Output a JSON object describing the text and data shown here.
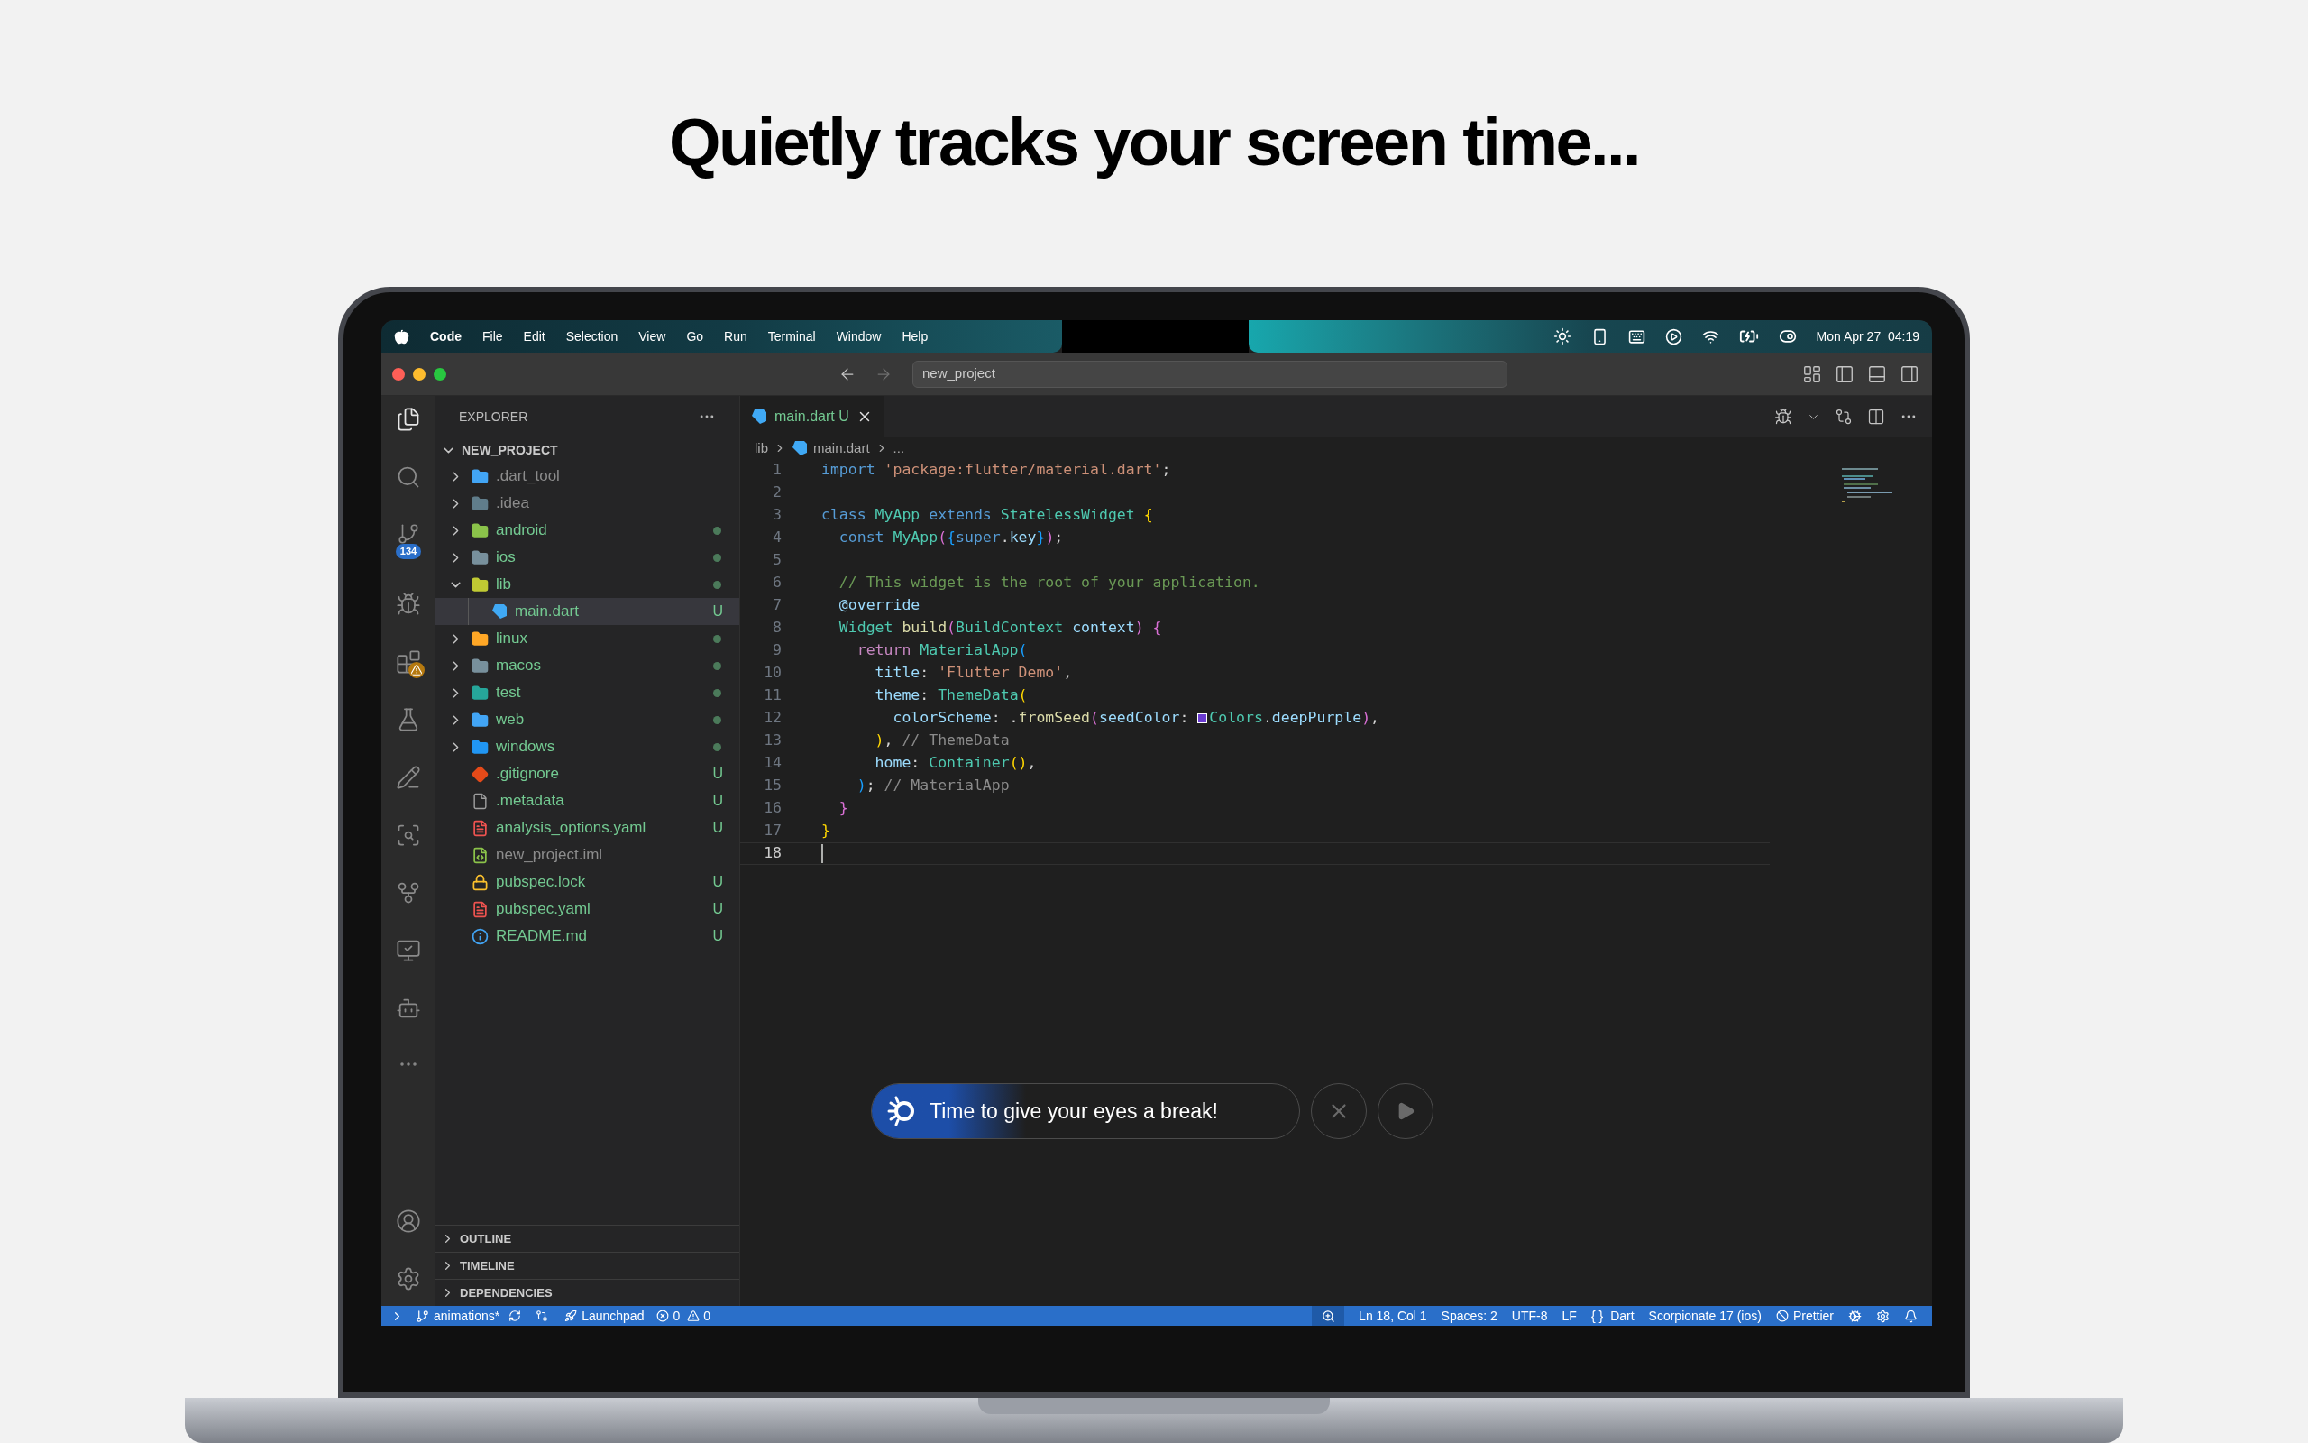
{
  "headline": "Quietly tracks your screen time...",
  "menu_bar": {
    "items": [
      {
        "label": "Code",
        "bold": true
      },
      {
        "label": "File",
        "bold": false
      },
      {
        "label": "Edit",
        "bold": false
      },
      {
        "label": "Selection",
        "bold": false
      },
      {
        "label": "View",
        "bold": false
      },
      {
        "label": "Go",
        "bold": false
      },
      {
        "label": "Run",
        "bold": false
      },
      {
        "label": "Terminal",
        "bold": false
      },
      {
        "label": "Window",
        "bold": false
      },
      {
        "label": "Help",
        "bold": false
      }
    ],
    "clock": "Mon Apr 27  04:19"
  },
  "title_bar": {
    "search": "new_project"
  },
  "activity_bar": {
    "source_control_badge": "134"
  },
  "explorer": {
    "title": "EXPLORER",
    "root": "NEW_PROJECT",
    "items": [
      {
        "name": ".dart_tool",
        "kind": "folder",
        "color": "#42a5f5",
        "expanded": false,
        "ignored": true,
        "dot": false,
        "selected": false
      },
      {
        "name": ".idea",
        "kind": "folder",
        "color": "#607d8b",
        "expanded": false,
        "ignored": true,
        "dot": false,
        "selected": false
      },
      {
        "name": "android",
        "kind": "folder",
        "color": "#8bc34a",
        "expanded": false,
        "ignored": false,
        "dot": true,
        "selected": false
      },
      {
        "name": "ios",
        "kind": "folder",
        "color": "#78909c",
        "expanded": false,
        "ignored": false,
        "dot": true,
        "selected": false
      },
      {
        "name": "lib",
        "kind": "folder",
        "color": "#c0ca33",
        "expanded": true,
        "ignored": false,
        "dot": true,
        "selected": false,
        "children": [
          {
            "name": "main.dart",
            "kind": "dart",
            "color": "#40a9f5",
            "ignored": false,
            "dot": false,
            "git": "U",
            "selected": true
          }
        ]
      },
      {
        "name": "linux",
        "kind": "folder",
        "color": "#ffa726",
        "expanded": false,
        "ignored": false,
        "dot": true,
        "selected": false
      },
      {
        "name": "macos",
        "kind": "folder",
        "color": "#78909c",
        "expanded": false,
        "ignored": false,
        "dot": true,
        "selected": false
      },
      {
        "name": "test",
        "kind": "folder",
        "color": "#26a69a",
        "expanded": false,
        "ignored": false,
        "dot": true,
        "selected": false
      },
      {
        "name": "web",
        "kind": "folder",
        "color": "#42a5f5",
        "expanded": false,
        "ignored": false,
        "dot": true,
        "selected": false
      },
      {
        "name": "windows",
        "kind": "folder",
        "color": "#2196f3",
        "expanded": false,
        "ignored": false,
        "dot": true,
        "selected": false
      },
      {
        "name": ".gitignore",
        "kind": "git",
        "color": "#e64a19",
        "ignored": false,
        "dot": false,
        "git": "U",
        "selected": false
      },
      {
        "name": ".metadata",
        "kind": "file",
        "color": "#9e9e9e",
        "ignored": false,
        "dot": false,
        "git": "U",
        "selected": false
      },
      {
        "name": "analysis_options.yaml",
        "kind": "doc",
        "color": "#ef5350",
        "ignored": false,
        "dot": false,
        "git": "U",
        "selected": false
      },
      {
        "name": "new_project.iml",
        "kind": "code",
        "color": "#8bc34a",
        "ignored": true,
        "dot": false,
        "selected": false
      },
      {
        "name": "pubspec.lock",
        "kind": "lock",
        "color": "#fbc02d",
        "ignored": false,
        "dot": false,
        "git": "U",
        "selected": false
      },
      {
        "name": "pubspec.yaml",
        "kind": "doc",
        "color": "#ef5350",
        "ignored": false,
        "dot": false,
        "git": "U",
        "selected": false
      },
      {
        "name": "README.md",
        "kind": "info",
        "color": "#42a5f5",
        "ignored": false,
        "dot": false,
        "git": "U",
        "selected": false
      }
    ],
    "sections": [
      {
        "label": "OUTLINE",
        "expanded": false
      },
      {
        "label": "TIMELINE",
        "expanded": false
      },
      {
        "label": "DEPENDENCIES",
        "expanded": false
      }
    ]
  },
  "editor": {
    "tab": {
      "label": "main.dart",
      "git": "U",
      "selected": true
    },
    "breadcrumb": [
      "lib",
      "main.dart",
      "..."
    ],
    "lines": [
      {
        "n": "1",
        "current": false,
        "tokens": [
          {
            "text": "import",
            "kind": "kw"
          },
          {
            "text": " 'package:flutter/material.dart'",
            "kind": "str"
          },
          {
            "text": ";",
            "kind": "p"
          }
        ]
      },
      {
        "n": "2",
        "current": false
      },
      {
        "n": "3",
        "current": false,
        "tokens": [
          {
            "text": "class",
            "kind": "kw"
          },
          {
            "text": " MyApp",
            "kind": "type"
          },
          {
            "text": " extends",
            "kind": "kw"
          },
          {
            "text": " StatelessWidget",
            "kind": "type"
          },
          {
            "text": " {",
            "kind": "b1"
          }
        ]
      },
      {
        "n": "4",
        "current": false,
        "tokens": [
          {
            "text": "  const",
            "kind": "kw"
          },
          {
            "text": " MyApp",
            "kind": "type"
          },
          {
            "text": "(",
            "kind": "b2"
          },
          {
            "text": "{",
            "kind": "b3"
          },
          {
            "text": "super",
            "kind": "kw"
          },
          {
            "text": ".",
            "kind": "p"
          },
          {
            "text": "key",
            "kind": "var"
          },
          {
            "text": "}",
            "kind": "b3"
          },
          {
            "text": ")",
            "kind": "b2"
          },
          {
            "text": ";",
            "kind": "p"
          }
        ]
      },
      {
        "n": "5",
        "current": false
      },
      {
        "n": "6",
        "current": false,
        "tokens": [
          {
            "text": "  // This widget is the root of your application.",
            "kind": "com"
          }
        ]
      },
      {
        "n": "7",
        "current": false,
        "tokens": [
          {
            "text": "  @override",
            "kind": "var"
          }
        ]
      },
      {
        "n": "8",
        "current": false,
        "tokens": [
          {
            "text": "  Widget",
            "kind": "type"
          },
          {
            "text": " build",
            "kind": "fn"
          },
          {
            "text": "(",
            "kind": "b2"
          },
          {
            "text": "BuildContext",
            "kind": "type"
          },
          {
            "text": " context",
            "kind": "var"
          },
          {
            "text": ")",
            "kind": "b2"
          },
          {
            "text": " {",
            "kind": "b2"
          }
        ]
      },
      {
        "n": "9",
        "current": false,
        "tokens": [
          {
            "text": "    return",
            "kind": "ctl"
          },
          {
            "text": " MaterialApp",
            "kind": "type"
          },
          {
            "text": "(",
            "kind": "b3"
          }
        ]
      },
      {
        "n": "10",
        "current": false,
        "tokens": [
          {
            "text": "      title",
            "kind": "var"
          },
          {
            "text": ": ",
            "kind": "p"
          },
          {
            "text": "'Flutter Demo'",
            "kind": "str"
          },
          {
            "text": ",",
            "kind": "p"
          }
        ]
      },
      {
        "n": "11",
        "current": false,
        "tokens": [
          {
            "text": "      theme",
            "kind": "var"
          },
          {
            "text": ": ",
            "kind": "p"
          },
          {
            "text": "ThemeData",
            "kind": "type"
          },
          {
            "text": "(",
            "kind": "b1"
          }
        ]
      },
      {
        "n": "12",
        "current": false,
        "tokens": [
          {
            "text": "        colorScheme",
            "kind": "var"
          },
          {
            "text": ": .",
            "kind": "p"
          },
          {
            "text": "fromSeed",
            "kind": "fn"
          },
          {
            "text": "(",
            "kind": "b2"
          },
          {
            "text": "seedColor",
            "kind": "var"
          },
          {
            "text": ": ",
            "kind": "p"
          },
          {
            "text": "Colors",
            "kind": "type",
            "color": "#6a3bd1"
          },
          {
            "text": ".",
            "kind": "p"
          },
          {
            "text": "deepPurple",
            "kind": "var"
          },
          {
            "text": ")",
            "kind": "b2"
          },
          {
            "text": ",",
            "kind": "p"
          }
        ]
      },
      {
        "n": "13",
        "current": false,
        "tokens": [
          {
            "text": "      )",
            "kind": "b1"
          },
          {
            "text": ",",
            "kind": "p"
          },
          {
            "text": " // ThemeData",
            "kind": "hint"
          }
        ]
      },
      {
        "n": "14",
        "current": false,
        "tokens": [
          {
            "text": "      home",
            "kind": "var"
          },
          {
            "text": ": ",
            "kind": "p"
          },
          {
            "text": "Container",
            "kind": "type"
          },
          {
            "text": "()",
            "kind": "b1"
          },
          {
            "text": ",",
            "kind": "p"
          }
        ]
      },
      {
        "n": "15",
        "current": false,
        "tokens": [
          {
            "text": "    )",
            "kind": "b3"
          },
          {
            "text": ";",
            "kind": "p"
          },
          {
            "text": " // MaterialApp",
            "kind": "hint"
          }
        ]
      },
      {
        "n": "16",
        "current": false,
        "tokens": [
          {
            "text": "  }",
            "kind": "b2"
          }
        ]
      },
      {
        "n": "17",
        "current": false,
        "tokens": [
          {
            "text": "}",
            "kind": "b1"
          }
        ]
      },
      {
        "n": "18",
        "current": true
      }
    ]
  },
  "break_prompt": {
    "text": "Time to give your eyes a break!",
    "level": 0.36
  },
  "status_bar": {
    "branch": "animations*",
    "launchpad": "Launchpad",
    "errors": "0",
    "warnings": "0",
    "position": "Ln 18, Col 1",
    "spaces": "Spaces: 2",
    "encoding": "UTF-8",
    "eol": "LF",
    "braces": "{ }",
    "language": "Dart",
    "device": "Scorpionate 17 (ios)",
    "formatter": "Prettier"
  }
}
